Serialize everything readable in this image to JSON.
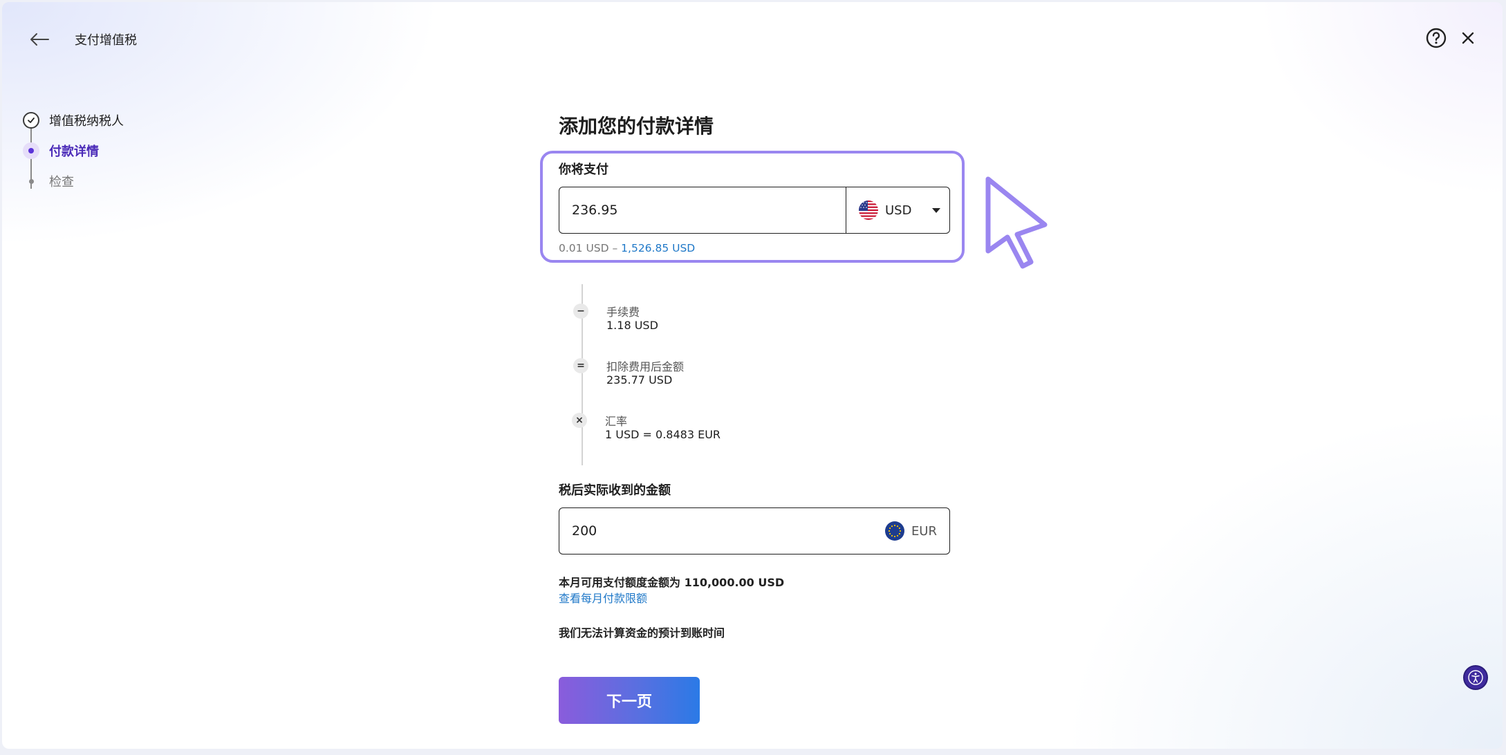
{
  "header": {
    "title": "支付增值税"
  },
  "stepper": {
    "steps": [
      {
        "label": "增值税纳税人",
        "state": "done"
      },
      {
        "label": "付款详情",
        "state": "active"
      },
      {
        "label": "检查",
        "state": "pending"
      }
    ]
  },
  "form": {
    "title": "添加您的付款详情",
    "pay": {
      "label": "你将支付",
      "value": "236.95",
      "currency": "USD",
      "range_min": "0.01 USD – ",
      "range_max": "1,526.85 USD"
    },
    "breakdown": [
      {
        "icon": "−",
        "label": "手续费",
        "value": "1.18 USD"
      },
      {
        "icon": "=",
        "label": "扣除费用后金额",
        "value": "235.77 USD"
      },
      {
        "icon": "×",
        "label": "汇率",
        "value": "1 USD = 0.8483 EUR"
      }
    ],
    "receive": {
      "label": "税后实际收到的金额",
      "value": "200",
      "currency": "EUR"
    },
    "monthly_limit_text": "本月可用支付额度金额为 110,000.00 USD",
    "monthly_limit_link": "查看每月付款限额",
    "eta_text": "我们无法计算资金的预计到账时间",
    "next_label": "下一页"
  },
  "colors": {
    "accent": "#5b34d8",
    "highlight_border": "#9a86f0",
    "link": "#1f78c8"
  }
}
